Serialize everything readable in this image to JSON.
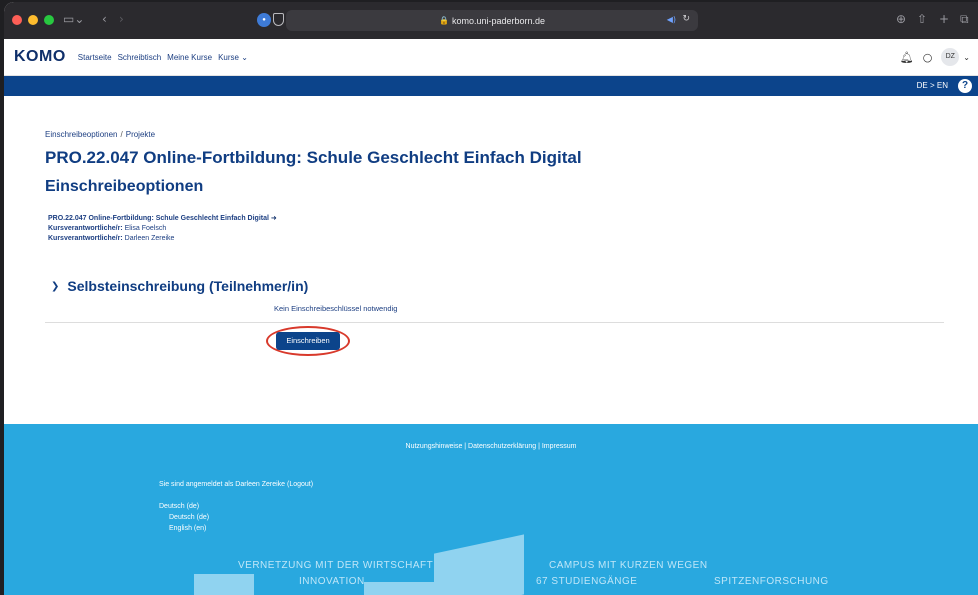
{
  "browser": {
    "url": "komo.uni-paderborn.de"
  },
  "header": {
    "logo": "KOMO",
    "nav": [
      "Startseite",
      "Schreibtisch",
      "Meine Kurse",
      "Kurse ⌄"
    ],
    "avatar_initials": "DZ"
  },
  "bluebar": {
    "lang_switch": "DE > EN",
    "help": "?"
  },
  "breadcrumb": [
    "Einschreibeoptionen",
    "Projekte"
  ],
  "course": {
    "title": "PRO.22.047 Online-Fortbildung: Schule Geschlecht Einfach Digital",
    "section_title": "Einschreibeoptionen",
    "link_name": "PRO.22.047 Online-Fortbildung: Schule Geschlecht Einfach Digital",
    "teachers": [
      {
        "role": "Kursverantwortliche/r:",
        "name": "Elisa Foelsch"
      },
      {
        "role": "Kursverantwortliche/r:",
        "name": "Darleen Zereike"
      }
    ]
  },
  "enrol": {
    "heading": "Selbsteinschreibung (Teilnehmer/in)",
    "no_key": "Kein Einschreibeschlüssel notwendig",
    "button": "Einschreiben"
  },
  "footer": {
    "links": "Nutzungshinweise | Datenschutzerklärung | Impressum",
    "login_info": "Sie sind angemeldet als Darleen Zereike (Logout)",
    "lang_current": "Deutsch (de)",
    "lang_options": [
      "Deutsch (de)",
      "English (en)"
    ],
    "slogans": [
      "VERNETZUNG MIT DER WIRTSCHAFT",
      "INNOVATION",
      "CAMPUS MIT KURZEN WEGEN",
      "67 STUDIENGÄNGE",
      "SPITZENFORSCHUNG"
    ]
  }
}
